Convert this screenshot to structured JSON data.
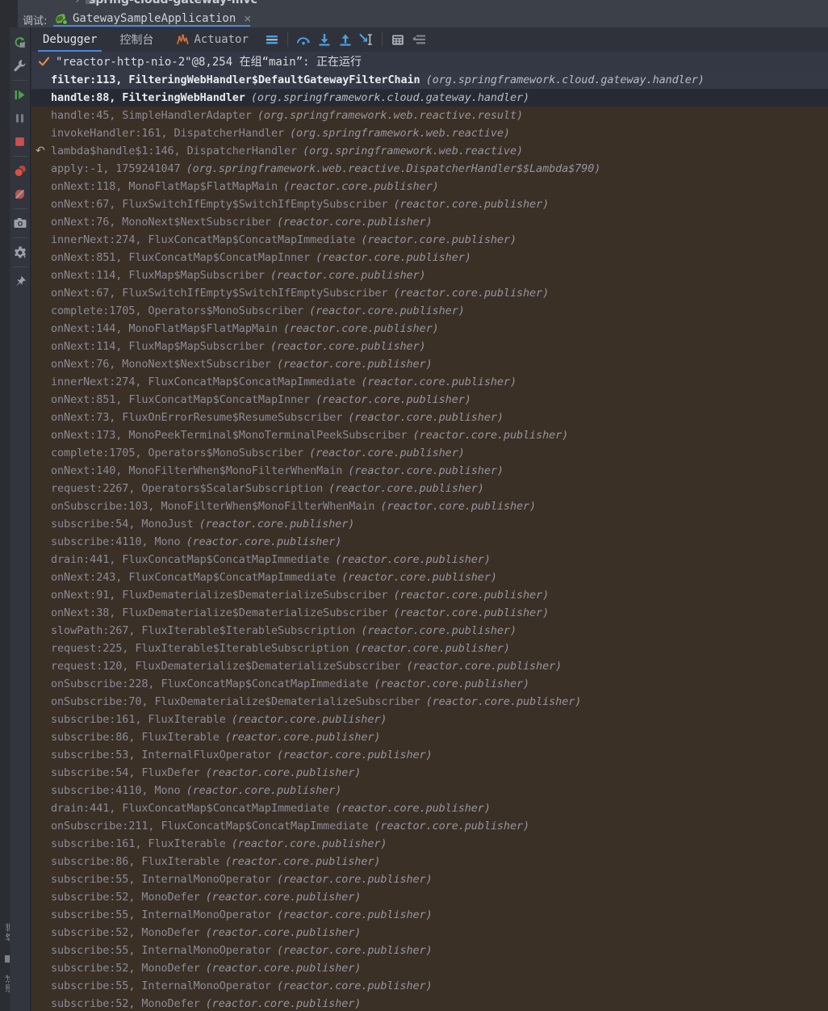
{
  "breadcrumb": {
    "project": "spring-cloud-gateway-mvc",
    "chevron": "›"
  },
  "titlebar": {
    "label": "调试:",
    "tab_name": "GatewaySampleApplication",
    "close_glyph": "×"
  },
  "left_rail": {
    "labels": [
      "终端",
      "调试"
    ],
    "buttons": [
      {
        "name": "rerun-button",
        "title": "Rerun"
      },
      {
        "name": "edit-configuration-button",
        "title": "Edit Configuration"
      },
      {
        "name": "resume-program-button",
        "title": "Resume Program"
      },
      {
        "name": "pause-program-button",
        "title": "Pause Program"
      },
      {
        "name": "stop-button",
        "title": "Stop"
      },
      {
        "name": "view-breakpoints-button",
        "title": "View Breakpoints"
      },
      {
        "name": "mute-breakpoints-button",
        "title": "Mute Breakpoints"
      },
      {
        "name": "screenshot-button",
        "title": "Screenshot"
      },
      {
        "name": "settings-button",
        "title": "Settings"
      },
      {
        "name": "pin-tab-button",
        "title": "Pin Tab"
      }
    ]
  },
  "tabs": [
    {
      "label": "Debugger",
      "active": true,
      "icon": null
    },
    {
      "label": "控制台",
      "active": false,
      "icon": null
    },
    {
      "label": "Actuator",
      "active": false,
      "icon": "actuator-icon"
    }
  ],
  "toolbar": {
    "icons": [
      {
        "name": "threads-and-variables-icon",
        "title": "Threads & Variables"
      },
      {
        "name": "step-over-icon",
        "title": "Step Over"
      },
      {
        "name": "step-into-icon",
        "title": "Step Into"
      },
      {
        "name": "step-out-icon",
        "title": "Step Out"
      },
      {
        "name": "run-to-cursor-icon",
        "title": "Run to Cursor"
      },
      {
        "name": "evaluate-expression-icon",
        "title": "Evaluate Expression"
      },
      {
        "name": "frames-filter-icon",
        "title": "Filter Frames"
      }
    ]
  },
  "thread": {
    "status_glyph": "✓",
    "text": "\"reactor-http-nio-2\"@8,254 在组“main”: 正在运行"
  },
  "colors": {
    "accent_blue": "#4a88d8",
    "check_orange": "#e08c3a",
    "stack_background": "#3a3026",
    "selected_row": "#353946",
    "current_frame_row": "#272a33"
  },
  "frames": [
    {
      "fn": "filter:113, FilteringWebHandler$DefaultGatewayFilterChain",
      "pkg": "(org.springframework.cloud.gateway.handler)",
      "style": "sel-light",
      "icon": null
    },
    {
      "fn": "handle:88, FilteringWebHandler",
      "pkg": "(org.springframework.cloud.gateway.handler)",
      "style": "sel-dark",
      "icon": null
    },
    {
      "fn": "handle:45, SimpleHandlerAdapter",
      "pkg": "(org.springframework.web.reactive.result)",
      "style": "lib",
      "icon": null
    },
    {
      "fn": "invokeHandler:161, DispatcherHandler",
      "pkg": "(org.springframework.web.reactive)",
      "style": "lib",
      "icon": null
    },
    {
      "fn": "lambda$handle$1:146, DispatcherHandler",
      "pkg": "(org.springframework.web.reactive)",
      "style": "lib",
      "icon": "return-icon"
    },
    {
      "fn": "apply:-1, 1759241047",
      "pkg": "(org.springframework.web.reactive.DispatcherHandler$$Lambda$790)",
      "style": "lib",
      "icon": null
    },
    {
      "fn": "onNext:118, MonoFlatMap$FlatMapMain",
      "pkg": "(reactor.core.publisher)",
      "style": "lib",
      "icon": null
    },
    {
      "fn": "onNext:67, FluxSwitchIfEmpty$SwitchIfEmptySubscriber",
      "pkg": "(reactor.core.publisher)",
      "style": "lib",
      "icon": null
    },
    {
      "fn": "onNext:76, MonoNext$NextSubscriber",
      "pkg": "(reactor.core.publisher)",
      "style": "lib",
      "icon": null
    },
    {
      "fn": "innerNext:274, FluxConcatMap$ConcatMapImmediate",
      "pkg": "(reactor.core.publisher)",
      "style": "lib",
      "icon": null
    },
    {
      "fn": "onNext:851, FluxConcatMap$ConcatMapInner",
      "pkg": "(reactor.core.publisher)",
      "style": "lib",
      "icon": null
    },
    {
      "fn": "onNext:114, FluxMap$MapSubscriber",
      "pkg": "(reactor.core.publisher)",
      "style": "lib",
      "icon": null
    },
    {
      "fn": "onNext:67, FluxSwitchIfEmpty$SwitchIfEmptySubscriber",
      "pkg": "(reactor.core.publisher)",
      "style": "lib",
      "icon": null
    },
    {
      "fn": "complete:1705, Operators$MonoSubscriber",
      "pkg": "(reactor.core.publisher)",
      "style": "lib",
      "icon": null
    },
    {
      "fn": "onNext:144, MonoFlatMap$FlatMapMain",
      "pkg": "(reactor.core.publisher)",
      "style": "lib",
      "icon": null
    },
    {
      "fn": "onNext:114, FluxMap$MapSubscriber",
      "pkg": "(reactor.core.publisher)",
      "style": "lib",
      "icon": null
    },
    {
      "fn": "onNext:76, MonoNext$NextSubscriber",
      "pkg": "(reactor.core.publisher)",
      "style": "lib",
      "icon": null
    },
    {
      "fn": "innerNext:274, FluxConcatMap$ConcatMapImmediate",
      "pkg": "(reactor.core.publisher)",
      "style": "lib",
      "icon": null
    },
    {
      "fn": "onNext:851, FluxConcatMap$ConcatMapInner",
      "pkg": "(reactor.core.publisher)",
      "style": "lib",
      "icon": null
    },
    {
      "fn": "onNext:73, FluxOnErrorResume$ResumeSubscriber",
      "pkg": "(reactor.core.publisher)",
      "style": "lib",
      "icon": null
    },
    {
      "fn": "onNext:173, MonoPeekTerminal$MonoTerminalPeekSubscriber",
      "pkg": "(reactor.core.publisher)",
      "style": "lib",
      "icon": null
    },
    {
      "fn": "complete:1705, Operators$MonoSubscriber",
      "pkg": "(reactor.core.publisher)",
      "style": "lib",
      "icon": null
    },
    {
      "fn": "onNext:140, MonoFilterWhen$MonoFilterWhenMain",
      "pkg": "(reactor.core.publisher)",
      "style": "lib",
      "icon": null
    },
    {
      "fn": "request:2267, Operators$ScalarSubscription",
      "pkg": "(reactor.core.publisher)",
      "style": "lib",
      "icon": null
    },
    {
      "fn": "onSubscribe:103, MonoFilterWhen$MonoFilterWhenMain",
      "pkg": "(reactor.core.publisher)",
      "style": "lib",
      "icon": null
    },
    {
      "fn": "subscribe:54, MonoJust",
      "pkg": "(reactor.core.publisher)",
      "style": "lib",
      "icon": null
    },
    {
      "fn": "subscribe:4110, Mono",
      "pkg": "(reactor.core.publisher)",
      "style": "lib",
      "icon": null
    },
    {
      "fn": "drain:441, FluxConcatMap$ConcatMapImmediate",
      "pkg": "(reactor.core.publisher)",
      "style": "lib",
      "icon": null
    },
    {
      "fn": "onNext:243, FluxConcatMap$ConcatMapImmediate",
      "pkg": "(reactor.core.publisher)",
      "style": "lib",
      "icon": null
    },
    {
      "fn": "onNext:91, FluxDematerialize$DematerializeSubscriber",
      "pkg": "(reactor.core.publisher)",
      "style": "lib",
      "icon": null
    },
    {
      "fn": "onNext:38, FluxDematerialize$DematerializeSubscriber",
      "pkg": "(reactor.core.publisher)",
      "style": "lib",
      "icon": null
    },
    {
      "fn": "slowPath:267, FluxIterable$IterableSubscription",
      "pkg": "(reactor.core.publisher)",
      "style": "lib",
      "icon": null
    },
    {
      "fn": "request:225, FluxIterable$IterableSubscription",
      "pkg": "(reactor.core.publisher)",
      "style": "lib",
      "icon": null
    },
    {
      "fn": "request:120, FluxDematerialize$DematerializeSubscriber",
      "pkg": "(reactor.core.publisher)",
      "style": "lib",
      "icon": null
    },
    {
      "fn": "onSubscribe:228, FluxConcatMap$ConcatMapImmediate",
      "pkg": "(reactor.core.publisher)",
      "style": "lib",
      "icon": null
    },
    {
      "fn": "onSubscribe:70, FluxDematerialize$DematerializeSubscriber",
      "pkg": "(reactor.core.publisher)",
      "style": "lib",
      "icon": null
    },
    {
      "fn": "subscribe:161, FluxIterable",
      "pkg": "(reactor.core.publisher)",
      "style": "lib",
      "icon": null
    },
    {
      "fn": "subscribe:86, FluxIterable",
      "pkg": "(reactor.core.publisher)",
      "style": "lib",
      "icon": null
    },
    {
      "fn": "subscribe:53, InternalFluxOperator",
      "pkg": "(reactor.core.publisher)",
      "style": "lib",
      "icon": null
    },
    {
      "fn": "subscribe:54, FluxDefer",
      "pkg": "(reactor.core.publisher)",
      "style": "lib",
      "icon": null
    },
    {
      "fn": "subscribe:4110, Mono",
      "pkg": "(reactor.core.publisher)",
      "style": "lib",
      "icon": null
    },
    {
      "fn": "drain:441, FluxConcatMap$ConcatMapImmediate",
      "pkg": "(reactor.core.publisher)",
      "style": "lib",
      "icon": null
    },
    {
      "fn": "onSubscribe:211, FluxConcatMap$ConcatMapImmediate",
      "pkg": "(reactor.core.publisher)",
      "style": "lib",
      "icon": null
    },
    {
      "fn": "subscribe:161, FluxIterable",
      "pkg": "(reactor.core.publisher)",
      "style": "lib",
      "icon": null
    },
    {
      "fn": "subscribe:86, FluxIterable",
      "pkg": "(reactor.core.publisher)",
      "style": "lib",
      "icon": null
    },
    {
      "fn": "subscribe:55, InternalMonoOperator",
      "pkg": "(reactor.core.publisher)",
      "style": "lib",
      "icon": null
    },
    {
      "fn": "subscribe:52, MonoDefer",
      "pkg": "(reactor.core.publisher)",
      "style": "lib",
      "icon": null
    },
    {
      "fn": "subscribe:55, InternalMonoOperator",
      "pkg": "(reactor.core.publisher)",
      "style": "lib",
      "icon": null
    },
    {
      "fn": "subscribe:52, MonoDefer",
      "pkg": "(reactor.core.publisher)",
      "style": "lib",
      "icon": null
    },
    {
      "fn": "subscribe:55, InternalMonoOperator",
      "pkg": "(reactor.core.publisher)",
      "style": "lib",
      "icon": null
    },
    {
      "fn": "subscribe:52, MonoDefer",
      "pkg": "(reactor.core.publisher)",
      "style": "lib",
      "icon": null
    },
    {
      "fn": "subscribe:55, InternalMonoOperator",
      "pkg": "(reactor.core.publisher)",
      "style": "lib",
      "icon": null
    },
    {
      "fn": "subscribe:52, MonoDefer",
      "pkg": "(reactor.core.publisher)",
      "style": "lib",
      "icon": null
    }
  ]
}
